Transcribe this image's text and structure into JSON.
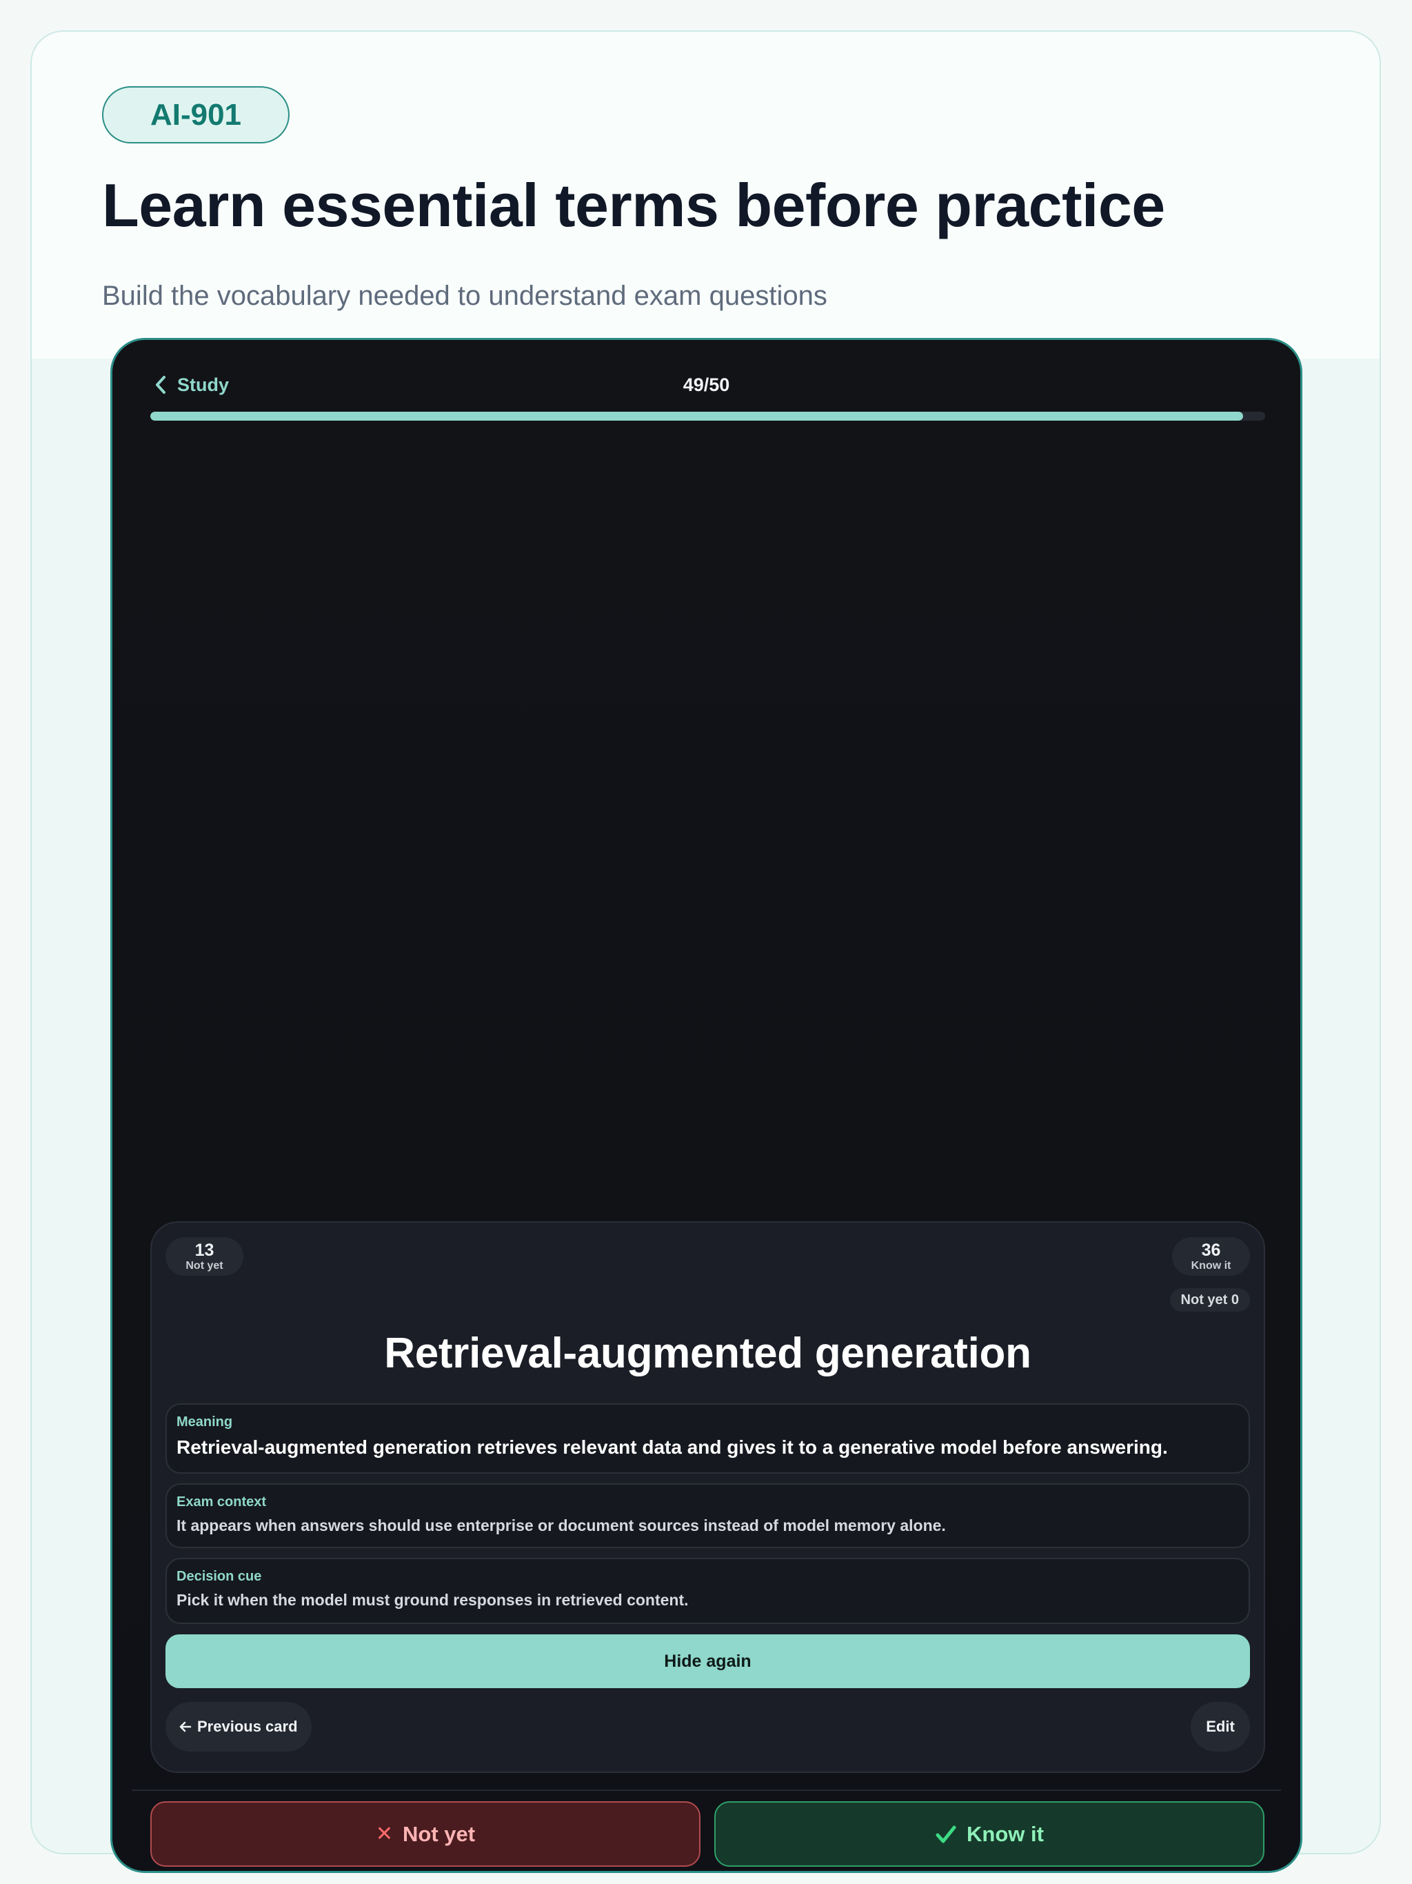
{
  "header": {
    "badge": "AI-901",
    "title": "Learn essential terms before practice",
    "subtitle": "Build the vocabulary needed to understand exam questions"
  },
  "study": {
    "back_label": "Study",
    "progress_text": "49/50",
    "progress_fraction": 0.98
  },
  "counts": {
    "not_yet": {
      "value": "13",
      "label": "Not yet"
    },
    "know_it": {
      "value": "36",
      "label": "Know it"
    },
    "card_chip": "Not yet 0"
  },
  "card": {
    "term": "Retrieval-augmented generation",
    "meaning_label": "Meaning",
    "meaning_text": "Retrieval-augmented generation retrieves relevant data and gives it to a generative model before answering.",
    "context_label": "Exam context",
    "context_text": "It appears when answers should use enterprise or document sources instead of model memory alone.",
    "cue_label": "Decision cue",
    "cue_text": "Pick it when the model must ground responses in retrieved content."
  },
  "controls": {
    "hide_label": "Hide again",
    "prev_label": "Previous card",
    "edit_label": "Edit",
    "not_yet_label": "Not yet",
    "know_it_label": "Know it"
  },
  "colors": {
    "accent": "#8fd8cb",
    "badge_text": "#137a70",
    "danger": "#ff6b6b",
    "success": "#2f9e6a"
  },
  "icons": {
    "back": "chevron-left-icon",
    "prev": "arrow-left-icon",
    "not_yet": "x-icon",
    "know_it": "checkmark-icon"
  }
}
